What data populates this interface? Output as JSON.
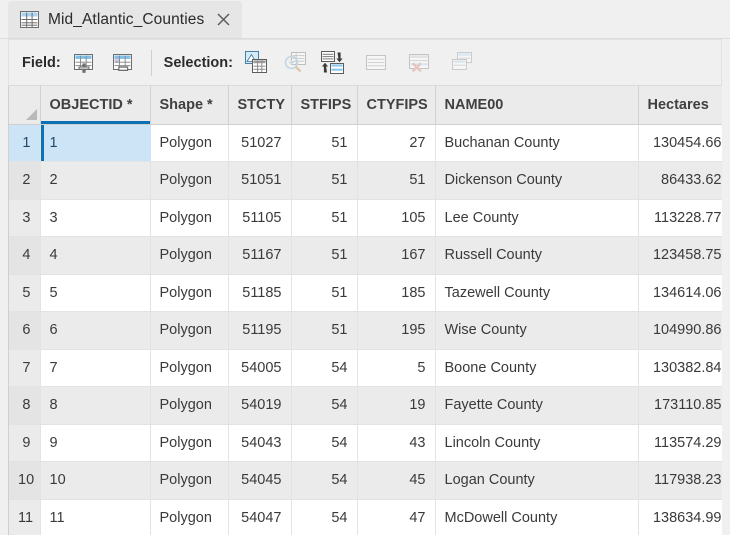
{
  "window": {
    "tab": {
      "icon": "table-icon",
      "title": "Mid_Atlantic_Counties",
      "close_label": "✕"
    }
  },
  "toolbar": {
    "field_label": "Field:",
    "selection_label": "Selection:",
    "field_buttons": [
      {
        "name": "add-field-icon",
        "tooltip": "Add Field",
        "enabled": true
      },
      {
        "name": "calculate-field-icon",
        "tooltip": "Calculate Field",
        "enabled": true
      }
    ],
    "selection_buttons": [
      {
        "name": "select-by-attributes-icon",
        "tooltip": "Select By Attributes",
        "enabled": true
      },
      {
        "name": "zoom-to-selection-icon",
        "tooltip": "Zoom To Selection",
        "enabled": false
      },
      {
        "name": "switch-selection-icon",
        "tooltip": "Switch Selection",
        "enabled": true
      },
      {
        "name": "select-all-icon",
        "tooltip": "Select All",
        "enabled": false
      },
      {
        "name": "clear-selection-icon",
        "tooltip": "Clear Selection",
        "enabled": false
      },
      {
        "name": "delete-selection-icon",
        "tooltip": "Delete Selection",
        "enabled": false
      }
    ]
  },
  "table": {
    "corner_label": "",
    "columns": [
      {
        "key": "rownum",
        "label": "",
        "align": "right",
        "selected": false
      },
      {
        "key": "objectid",
        "label": "OBJECTID *",
        "align": "left",
        "selected": true
      },
      {
        "key": "shape",
        "label": "Shape *",
        "align": "left",
        "selected": false
      },
      {
        "key": "stcty",
        "label": "STCTY",
        "align": "right",
        "selected": false
      },
      {
        "key": "stfips",
        "label": "STFIPS",
        "align": "right",
        "selected": false
      },
      {
        "key": "ctyfips",
        "label": "CTYFIPS",
        "align": "right",
        "selected": false
      },
      {
        "key": "name00",
        "label": "NAME00",
        "align": "left",
        "selected": false
      },
      {
        "key": "hectares",
        "label": "Hectares",
        "align": "right",
        "selected": false
      }
    ],
    "rows": [
      {
        "rownum": "1",
        "objectid": "1",
        "shape": "Polygon",
        "stcty": "51027",
        "stfips": "51",
        "ctyfips": "27",
        "name00": "Buchanan County",
        "hectares": "130454.66",
        "selected": true
      },
      {
        "rownum": "2",
        "objectid": "2",
        "shape": "Polygon",
        "stcty": "51051",
        "stfips": "51",
        "ctyfips": "51",
        "name00": "Dickenson County",
        "hectares": "86433.62",
        "selected": false
      },
      {
        "rownum": "3",
        "objectid": "3",
        "shape": "Polygon",
        "stcty": "51105",
        "stfips": "51",
        "ctyfips": "105",
        "name00": "Lee County",
        "hectares": "113228.77",
        "selected": false
      },
      {
        "rownum": "4",
        "objectid": "4",
        "shape": "Polygon",
        "stcty": "51167",
        "stfips": "51",
        "ctyfips": "167",
        "name00": "Russell County",
        "hectares": "123458.75",
        "selected": false
      },
      {
        "rownum": "5",
        "objectid": "5",
        "shape": "Polygon",
        "stcty": "51185",
        "stfips": "51",
        "ctyfips": "185",
        "name00": "Tazewell County",
        "hectares": "134614.06",
        "selected": false
      },
      {
        "rownum": "6",
        "objectid": "6",
        "shape": "Polygon",
        "stcty": "51195",
        "stfips": "51",
        "ctyfips": "195",
        "name00": "Wise County",
        "hectares": "104990.86",
        "selected": false
      },
      {
        "rownum": "7",
        "objectid": "7",
        "shape": "Polygon",
        "stcty": "54005",
        "stfips": "54",
        "ctyfips": "5",
        "name00": "Boone County",
        "hectares": "130382.84",
        "selected": false
      },
      {
        "rownum": "8",
        "objectid": "8",
        "shape": "Polygon",
        "stcty": "54019",
        "stfips": "54",
        "ctyfips": "19",
        "name00": "Fayette County",
        "hectares": "173110.85",
        "selected": false
      },
      {
        "rownum": "9",
        "objectid": "9",
        "shape": "Polygon",
        "stcty": "54043",
        "stfips": "54",
        "ctyfips": "43",
        "name00": "Lincoln County",
        "hectares": "113574.29",
        "selected": false
      },
      {
        "rownum": "10",
        "objectid": "10",
        "shape": "Polygon",
        "stcty": "54045",
        "stfips": "54",
        "ctyfips": "45",
        "name00": "Logan County",
        "hectares": "117938.23",
        "selected": false
      },
      {
        "rownum": "11",
        "objectid": "11",
        "shape": "Polygon",
        "stcty": "54047",
        "stfips": "54",
        "ctyfips": "47",
        "name00": "McDowell County",
        "hectares": "138634.99",
        "selected": false
      }
    ]
  },
  "colors": {
    "selection_fill": "#cce4f6",
    "selection_accent": "#0a71b4",
    "header_text": "#404040",
    "chrome": "#f0f0f0"
  }
}
